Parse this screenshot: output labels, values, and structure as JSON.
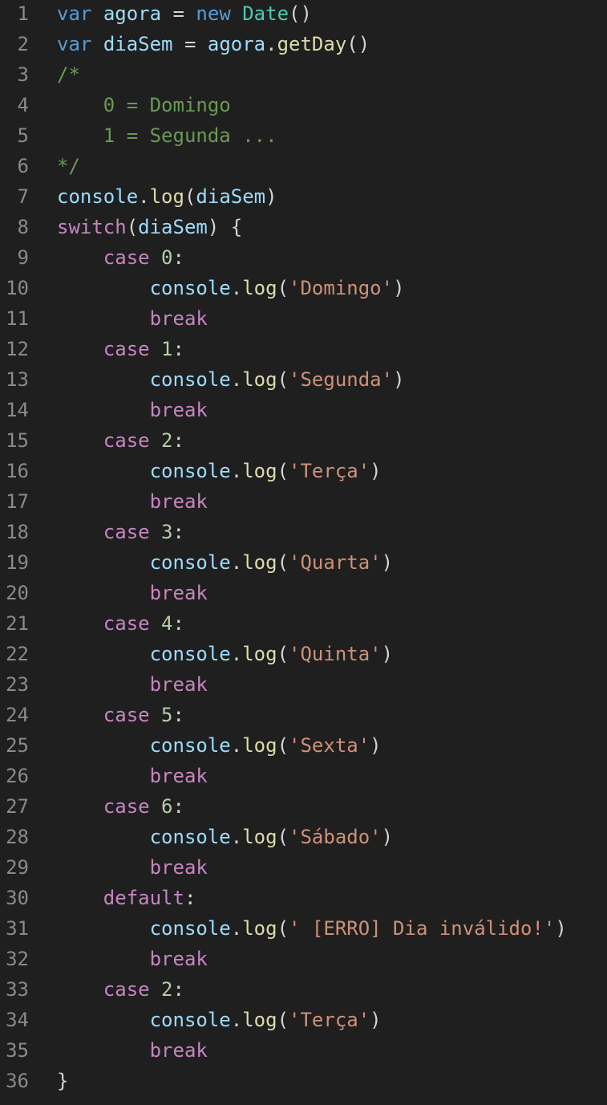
{
  "editor": {
    "lines": [
      {
        "num": "1",
        "tokens": [
          {
            "t": "var",
            "k": "keyword"
          },
          {
            "t": " ",
            "k": "punct"
          },
          {
            "t": "agora",
            "k": "var"
          },
          {
            "t": " = ",
            "k": "punct"
          },
          {
            "t": "new",
            "k": "keyword"
          },
          {
            "t": " ",
            "k": "punct"
          },
          {
            "t": "Date",
            "k": "class"
          },
          {
            "t": "()",
            "k": "punct"
          }
        ]
      },
      {
        "num": "2",
        "tokens": [
          {
            "t": "var",
            "k": "keyword"
          },
          {
            "t": " ",
            "k": "punct"
          },
          {
            "t": "diaSem",
            "k": "var"
          },
          {
            "t": " = ",
            "k": "punct"
          },
          {
            "t": "agora",
            "k": "var"
          },
          {
            "t": ".",
            "k": "punct"
          },
          {
            "t": "getDay",
            "k": "func"
          },
          {
            "t": "()",
            "k": "punct"
          }
        ]
      },
      {
        "num": "3",
        "tokens": [
          {
            "t": "/*",
            "k": "comment"
          }
        ]
      },
      {
        "num": "4",
        "tokens": [
          {
            "t": "    0 = Domingo",
            "k": "comment"
          }
        ]
      },
      {
        "num": "5",
        "tokens": [
          {
            "t": "    1 = Segunda ...",
            "k": "comment"
          }
        ]
      },
      {
        "num": "6",
        "tokens": [
          {
            "t": "*/",
            "k": "comment"
          }
        ]
      },
      {
        "num": "7",
        "tokens": [
          {
            "t": "console",
            "k": "var"
          },
          {
            "t": ".",
            "k": "punct"
          },
          {
            "t": "log",
            "k": "func"
          },
          {
            "t": "(",
            "k": "punct"
          },
          {
            "t": "diaSem",
            "k": "var"
          },
          {
            "t": ")",
            "k": "punct"
          }
        ]
      },
      {
        "num": "8",
        "tokens": [
          {
            "t": "switch",
            "k": "control"
          },
          {
            "t": "(",
            "k": "punct"
          },
          {
            "t": "diaSem",
            "k": "var"
          },
          {
            "t": ") {",
            "k": "punct"
          }
        ]
      },
      {
        "num": "9",
        "tokens": [
          {
            "t": "    ",
            "k": "punct"
          },
          {
            "t": "case",
            "k": "control"
          },
          {
            "t": " ",
            "k": "punct"
          },
          {
            "t": "0",
            "k": "number"
          },
          {
            "t": ":",
            "k": "punct"
          }
        ]
      },
      {
        "num": "10",
        "tokens": [
          {
            "t": "        ",
            "k": "punct"
          },
          {
            "t": "console",
            "k": "var"
          },
          {
            "t": ".",
            "k": "punct"
          },
          {
            "t": "log",
            "k": "func"
          },
          {
            "t": "(",
            "k": "punct"
          },
          {
            "t": "'Domingo'",
            "k": "string"
          },
          {
            "t": ")",
            "k": "punct"
          }
        ]
      },
      {
        "num": "11",
        "tokens": [
          {
            "t": "        ",
            "k": "punct"
          },
          {
            "t": "break",
            "k": "control"
          }
        ]
      },
      {
        "num": "12",
        "tokens": [
          {
            "t": "    ",
            "k": "punct"
          },
          {
            "t": "case",
            "k": "control"
          },
          {
            "t": " ",
            "k": "punct"
          },
          {
            "t": "1",
            "k": "number"
          },
          {
            "t": ":",
            "k": "punct"
          }
        ]
      },
      {
        "num": "13",
        "tokens": [
          {
            "t": "        ",
            "k": "punct"
          },
          {
            "t": "console",
            "k": "var"
          },
          {
            "t": ".",
            "k": "punct"
          },
          {
            "t": "log",
            "k": "func"
          },
          {
            "t": "(",
            "k": "punct"
          },
          {
            "t": "'Segunda'",
            "k": "string"
          },
          {
            "t": ")",
            "k": "punct"
          }
        ]
      },
      {
        "num": "14",
        "tokens": [
          {
            "t": "        ",
            "k": "punct"
          },
          {
            "t": "break",
            "k": "control"
          }
        ]
      },
      {
        "num": "15",
        "tokens": [
          {
            "t": "    ",
            "k": "punct"
          },
          {
            "t": "case",
            "k": "control"
          },
          {
            "t": " ",
            "k": "punct"
          },
          {
            "t": "2",
            "k": "number"
          },
          {
            "t": ":",
            "k": "punct"
          }
        ]
      },
      {
        "num": "16",
        "tokens": [
          {
            "t": "        ",
            "k": "punct"
          },
          {
            "t": "console",
            "k": "var"
          },
          {
            "t": ".",
            "k": "punct"
          },
          {
            "t": "log",
            "k": "func"
          },
          {
            "t": "(",
            "k": "punct"
          },
          {
            "t": "'Terça'",
            "k": "string"
          },
          {
            "t": ")",
            "k": "punct"
          }
        ]
      },
      {
        "num": "17",
        "tokens": [
          {
            "t": "        ",
            "k": "punct"
          },
          {
            "t": "break",
            "k": "control"
          }
        ]
      },
      {
        "num": "18",
        "tokens": [
          {
            "t": "    ",
            "k": "punct"
          },
          {
            "t": "case",
            "k": "control"
          },
          {
            "t": " ",
            "k": "punct"
          },
          {
            "t": "3",
            "k": "number"
          },
          {
            "t": ":",
            "k": "punct"
          }
        ]
      },
      {
        "num": "19",
        "tokens": [
          {
            "t": "        ",
            "k": "punct"
          },
          {
            "t": "console",
            "k": "var"
          },
          {
            "t": ".",
            "k": "punct"
          },
          {
            "t": "log",
            "k": "func"
          },
          {
            "t": "(",
            "k": "punct"
          },
          {
            "t": "'Quarta'",
            "k": "string"
          },
          {
            "t": ")",
            "k": "punct"
          }
        ]
      },
      {
        "num": "20",
        "tokens": [
          {
            "t": "        ",
            "k": "punct"
          },
          {
            "t": "break",
            "k": "control"
          }
        ]
      },
      {
        "num": "21",
        "tokens": [
          {
            "t": "    ",
            "k": "punct"
          },
          {
            "t": "case",
            "k": "control"
          },
          {
            "t": " ",
            "k": "punct"
          },
          {
            "t": "4",
            "k": "number"
          },
          {
            "t": ":",
            "k": "punct"
          }
        ]
      },
      {
        "num": "22",
        "tokens": [
          {
            "t": "        ",
            "k": "punct"
          },
          {
            "t": "console",
            "k": "var"
          },
          {
            "t": ".",
            "k": "punct"
          },
          {
            "t": "log",
            "k": "func"
          },
          {
            "t": "(",
            "k": "punct"
          },
          {
            "t": "'Quinta'",
            "k": "string"
          },
          {
            "t": ")",
            "k": "punct"
          }
        ]
      },
      {
        "num": "23",
        "tokens": [
          {
            "t": "        ",
            "k": "punct"
          },
          {
            "t": "break",
            "k": "control"
          }
        ]
      },
      {
        "num": "24",
        "tokens": [
          {
            "t": "    ",
            "k": "punct"
          },
          {
            "t": "case",
            "k": "control"
          },
          {
            "t": " ",
            "k": "punct"
          },
          {
            "t": "5",
            "k": "number"
          },
          {
            "t": ":",
            "k": "punct"
          }
        ]
      },
      {
        "num": "25",
        "tokens": [
          {
            "t": "        ",
            "k": "punct"
          },
          {
            "t": "console",
            "k": "var"
          },
          {
            "t": ".",
            "k": "punct"
          },
          {
            "t": "log",
            "k": "func"
          },
          {
            "t": "(",
            "k": "punct"
          },
          {
            "t": "'Sexta'",
            "k": "string"
          },
          {
            "t": ")",
            "k": "punct"
          }
        ]
      },
      {
        "num": "26",
        "tokens": [
          {
            "t": "        ",
            "k": "punct"
          },
          {
            "t": "break",
            "k": "control"
          }
        ]
      },
      {
        "num": "27",
        "tokens": [
          {
            "t": "    ",
            "k": "punct"
          },
          {
            "t": "case",
            "k": "control"
          },
          {
            "t": " ",
            "k": "punct"
          },
          {
            "t": "6",
            "k": "number"
          },
          {
            "t": ":",
            "k": "punct"
          }
        ]
      },
      {
        "num": "28",
        "tokens": [
          {
            "t": "        ",
            "k": "punct"
          },
          {
            "t": "console",
            "k": "var"
          },
          {
            "t": ".",
            "k": "punct"
          },
          {
            "t": "log",
            "k": "func"
          },
          {
            "t": "(",
            "k": "punct"
          },
          {
            "t": "'Sábado'",
            "k": "string"
          },
          {
            "t": ")",
            "k": "punct"
          }
        ]
      },
      {
        "num": "29",
        "tokens": [
          {
            "t": "        ",
            "k": "punct"
          },
          {
            "t": "break",
            "k": "control"
          }
        ]
      },
      {
        "num": "30",
        "tokens": [
          {
            "t": "    ",
            "k": "punct"
          },
          {
            "t": "default",
            "k": "control"
          },
          {
            "t": ":",
            "k": "punct"
          }
        ]
      },
      {
        "num": "31",
        "tokens": [
          {
            "t": "        ",
            "k": "punct"
          },
          {
            "t": "console",
            "k": "var"
          },
          {
            "t": ".",
            "k": "punct"
          },
          {
            "t": "log",
            "k": "func"
          },
          {
            "t": "(",
            "k": "punct"
          },
          {
            "t": "' [ERRO] Dia inválido!'",
            "k": "string"
          },
          {
            "t": ")",
            "k": "punct"
          }
        ]
      },
      {
        "num": "32",
        "tokens": [
          {
            "t": "        ",
            "k": "punct"
          },
          {
            "t": "break",
            "k": "control"
          }
        ]
      },
      {
        "num": "33",
        "tokens": [
          {
            "t": "    ",
            "k": "punct"
          },
          {
            "t": "case",
            "k": "control"
          },
          {
            "t": " ",
            "k": "punct"
          },
          {
            "t": "2",
            "k": "number"
          },
          {
            "t": ":",
            "k": "punct"
          }
        ]
      },
      {
        "num": "34",
        "tokens": [
          {
            "t": "        ",
            "k": "punct"
          },
          {
            "t": "console",
            "k": "var"
          },
          {
            "t": ".",
            "k": "punct"
          },
          {
            "t": "log",
            "k": "func"
          },
          {
            "t": "(",
            "k": "punct"
          },
          {
            "t": "'Terça'",
            "k": "string"
          },
          {
            "t": ")",
            "k": "punct"
          }
        ]
      },
      {
        "num": "35",
        "tokens": [
          {
            "t": "        ",
            "k": "punct"
          },
          {
            "t": "break",
            "k": "control"
          }
        ]
      },
      {
        "num": "36",
        "tokens": [
          {
            "t": "}",
            "k": "punct"
          }
        ]
      }
    ]
  },
  "colors": {
    "background": "#1f1f1f",
    "line_number": "#8a8a8a",
    "keyword": "#569cd6",
    "control": "#c586c0",
    "variable": "#9cdcfe",
    "function": "#dcdcaa",
    "class": "#4ec9b0",
    "string": "#ce9178",
    "number": "#b5cea8",
    "comment": "#6a9955",
    "text": "#d4d4d4"
  }
}
